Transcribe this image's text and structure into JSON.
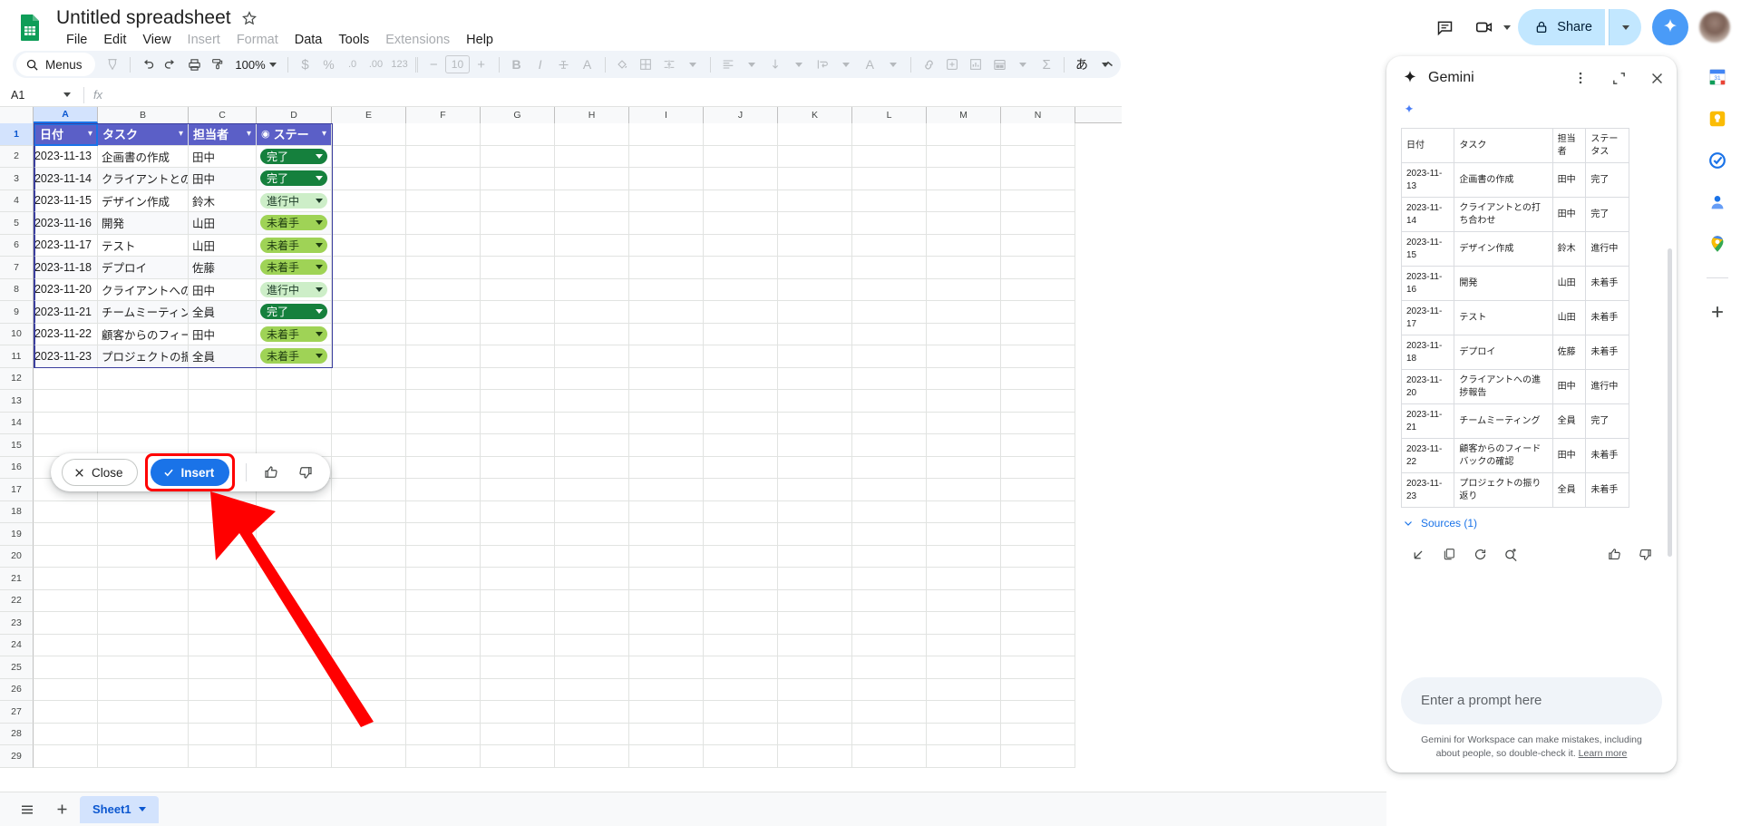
{
  "app": {
    "doc_title": "Untitled spreadsheet",
    "menus": [
      {
        "label": "File",
        "dim": false
      },
      {
        "label": "Edit",
        "dim": false
      },
      {
        "label": "View",
        "dim": false
      },
      {
        "label": "Insert",
        "dim": true
      },
      {
        "label": "Format",
        "dim": true
      },
      {
        "label": "Data",
        "dim": false
      },
      {
        "label": "Tools",
        "dim": false
      },
      {
        "label": "Extensions",
        "dim": true
      },
      {
        "label": "Help",
        "dim": false
      }
    ],
    "share_label": "Share"
  },
  "toolbar": {
    "menus_label": "Menus",
    "zoom_label": "100%",
    "font_size": "10",
    "currency": "$",
    "percent": "%",
    "dec_dec": ".0",
    "dec_inc": ".00",
    "more_formats": "123",
    "bold": "B",
    "italic": "I",
    "text_color": "A",
    "sigma": "Σ",
    "lang": "あ"
  },
  "formula_bar": {
    "name_box": "A1",
    "fx_label": "fx",
    "formula_value": ""
  },
  "grid": {
    "columns": [
      "A",
      "B",
      "C",
      "D",
      "E",
      "F",
      "G",
      "H",
      "I",
      "J",
      "K",
      "L",
      "M",
      "N"
    ],
    "selected_column": "A",
    "selected_row": 1,
    "row_numbers": [
      1,
      2,
      3,
      4,
      5,
      6,
      7,
      8,
      9,
      10,
      11,
      12,
      13,
      14,
      15,
      16,
      17,
      18,
      19,
      20,
      21,
      22,
      23,
      24,
      25,
      26,
      27,
      28,
      29
    ],
    "table_headers": [
      "日付",
      "タスク",
      "担当者",
      "ステー"
    ],
    "table_rows": [
      {
        "date": "2023-11-13",
        "task": "企画書の作成",
        "owner": "田中",
        "status": "完了",
        "status_kind": "done"
      },
      {
        "date": "2023-11-14",
        "task": "クライアントとの打",
        "owner": "田中",
        "status": "完了",
        "status_kind": "done"
      },
      {
        "date": "2023-11-15",
        "task": "デザイン作成",
        "owner": "鈴木",
        "status": "進行中",
        "status_kind": "prog"
      },
      {
        "date": "2023-11-16",
        "task": "開発",
        "owner": "山田",
        "status": "未着手",
        "status_kind": "todo"
      },
      {
        "date": "2023-11-17",
        "task": "テスト",
        "owner": "山田",
        "status": "未着手",
        "status_kind": "todo"
      },
      {
        "date": "2023-11-18",
        "task": "デプロイ",
        "owner": "佐藤",
        "status": "未着手",
        "status_kind": "todo"
      },
      {
        "date": "2023-11-20",
        "task": "クライアントへの進",
        "owner": "田中",
        "status": "進行中",
        "status_kind": "prog"
      },
      {
        "date": "2023-11-21",
        "task": "チームミーティング",
        "owner": "全員",
        "status": "完了",
        "status_kind": "done"
      },
      {
        "date": "2023-11-22",
        "task": "顧客からのフィード",
        "owner": "田中",
        "status": "未着手",
        "status_kind": "todo"
      },
      {
        "date": "2023-11-23",
        "task": "プロジェクトの振り",
        "owner": "全員",
        "status": "未着手",
        "status_kind": "todo"
      }
    ]
  },
  "result_bar": {
    "close_label": "Close",
    "insert_label": "Insert"
  },
  "gemini": {
    "title": "Gemini",
    "table_headers": [
      "日付",
      "タスク",
      "担当者",
      "ステータス"
    ],
    "table_rows": [
      {
        "date": "2023-11-13",
        "task": "企画書の作成",
        "owner": "田中",
        "status": "完了"
      },
      {
        "date": "2023-11-14",
        "task": "クライアントとの打ち合わせ",
        "owner": "田中",
        "status": "完了"
      },
      {
        "date": "2023-11-15",
        "task": "デザイン作成",
        "owner": "鈴木",
        "status": "進行中"
      },
      {
        "date": "2023-11-16",
        "task": "開発",
        "owner": "山田",
        "status": "未着手"
      },
      {
        "date": "2023-11-17",
        "task": "テスト",
        "owner": "山田",
        "status": "未着手"
      },
      {
        "date": "2023-11-18",
        "task": "デプロイ",
        "owner": "佐藤",
        "status": "未着手"
      },
      {
        "date": "2023-11-20",
        "task": "クライアントへの進捗報告",
        "owner": "田中",
        "status": "進行中"
      },
      {
        "date": "2023-11-21",
        "task": "チームミーティング",
        "owner": "全員",
        "status": "完了"
      },
      {
        "date": "2023-11-22",
        "task": "顧客からのフィードバックの確認",
        "owner": "田中",
        "status": "未着手"
      },
      {
        "date": "2023-11-23",
        "task": "プロジェクトの振り返り",
        "owner": "全員",
        "status": "未着手"
      }
    ],
    "sources_label": "Sources (1)",
    "prompt_placeholder": "Enter a prompt here",
    "disclaimer": "Gemini for Workspace can make mistakes, including about people, so double-check it.",
    "learn_more": "Learn more"
  },
  "bottom": {
    "sheet_tab": "Sheet1"
  },
  "colors": {
    "accent_blue": "#1a73e8",
    "table_header_purple": "#5b5fc7",
    "status_done": "#15803d",
    "status_progress": "#cdeec8",
    "status_todo": "#9fd356",
    "annotation_red": "#ff0000",
    "share_bg": "#c2e7ff"
  }
}
